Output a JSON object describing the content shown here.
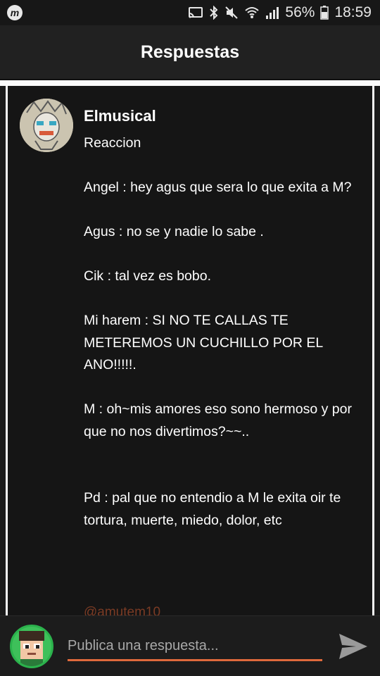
{
  "status_bar": {
    "battery": "56%",
    "time": "18:59"
  },
  "header": {
    "title": "Respuestas"
  },
  "post": {
    "author": "Elmusical",
    "body": "Reaccion\n\nAngel : hey agus que sera lo que exita a M?\n\nAgus : no se y nadie lo sabe .\n\nCik : tal vez es bobo.\n\nMi harem : SI NO TE CALLAS TE METEREMOS UN CUCHILLO POR EL ANO!!!!!.\n\nM : oh~mis amores eso sono hermoso y por que no nos divertimos?~~..\n\n\nPd : pal que no entendio a M le exita oir te tortura, muerte, miedo, dolor, etc",
    "mention_partial": "@amutem10"
  },
  "composer": {
    "placeholder": "Publica una respuesta..."
  },
  "colors": {
    "accent": "#e06a3c",
    "background": "#151515",
    "header": "#212121",
    "green": "#2bb24c"
  },
  "icons": {
    "app": "m-badge-icon",
    "cast": "cast-icon",
    "bluetooth": "bluetooth-icon",
    "mute": "mute-icon",
    "wifi": "wifi-icon",
    "signal": "signal-icon",
    "battery": "battery-icon",
    "send": "send-icon"
  }
}
